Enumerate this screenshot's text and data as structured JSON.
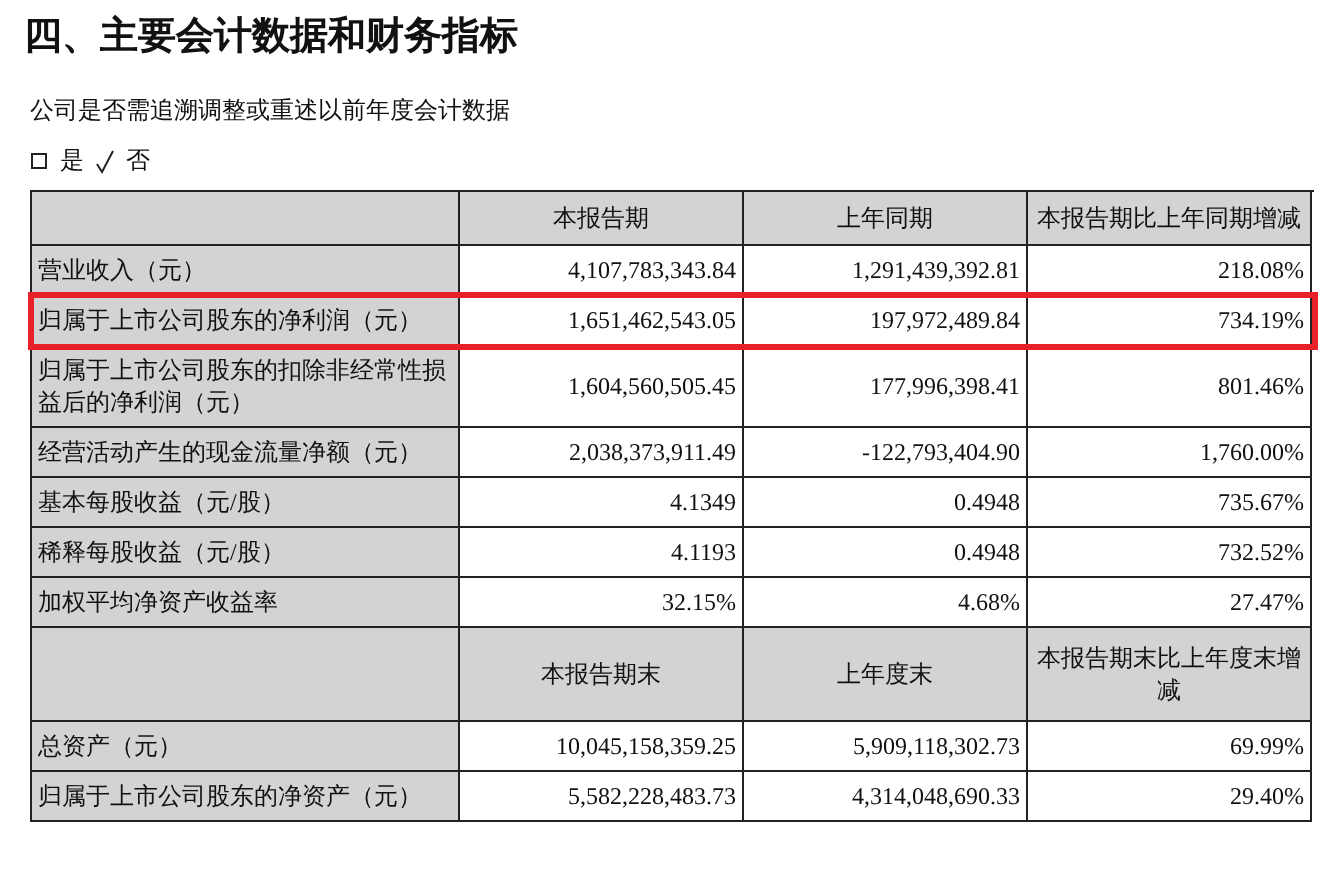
{
  "title": "四、主要会计数据和财务指标",
  "question": "公司是否需追溯调整或重述以前年度会计数据",
  "options": [
    {
      "label": "是",
      "checked": false
    },
    {
      "label": "否",
      "checked": true
    }
  ],
  "table": {
    "rows": [
      {
        "kind": "header",
        "cells": [
          "",
          "本报告期",
          "上年同期",
          "本报告期比上年同期增减"
        ],
        "highlighted": false
      },
      {
        "kind": "data",
        "cells": [
          "营业收入（元）",
          "4,107,783,343.84",
          "1,291,439,392.81",
          "218.08%"
        ],
        "highlighted": false
      },
      {
        "kind": "data",
        "cells": [
          "归属于上市公司股东的净利润（元）",
          "1,651,462,543.05",
          "197,972,489.84",
          "734.19%"
        ],
        "highlighted": true
      },
      {
        "kind": "data",
        "cells": [
          "归属于上市公司股东的扣除非经常性损益后的净利润（元）",
          "1,604,560,505.45",
          "177,996,398.41",
          "801.46%"
        ],
        "highlighted": false
      },
      {
        "kind": "data",
        "cells": [
          "经营活动产生的现金流量净额（元）",
          "2,038,373,911.49",
          "-122,793,404.90",
          "1,760.00%"
        ],
        "highlighted": false
      },
      {
        "kind": "data",
        "cells": [
          "基本每股收益（元/股）",
          "4.1349",
          "0.4948",
          "735.67%"
        ],
        "highlighted": false
      },
      {
        "kind": "data",
        "cells": [
          "稀释每股收益（元/股）",
          "4.1193",
          "0.4948",
          "732.52%"
        ],
        "highlighted": false
      },
      {
        "kind": "data",
        "cells": [
          "加权平均净资产收益率",
          "32.15%",
          "4.68%",
          "27.47%"
        ],
        "highlighted": false
      },
      {
        "kind": "header",
        "cells": [
          "",
          "本报告期末",
          "上年度末",
          "本报告期末比上年度末增减"
        ],
        "highlighted": false
      },
      {
        "kind": "data",
        "cells": [
          "总资产（元）",
          "10,045,158,359.25",
          "5,909,118,302.73",
          "69.99%"
        ],
        "highlighted": false
      },
      {
        "kind": "data",
        "cells": [
          "归属于上市公司股东的净资产（元）",
          "5,582,228,483.73",
          "4,314,048,690.33",
          "29.40%"
        ],
        "highlighted": false
      }
    ]
  }
}
